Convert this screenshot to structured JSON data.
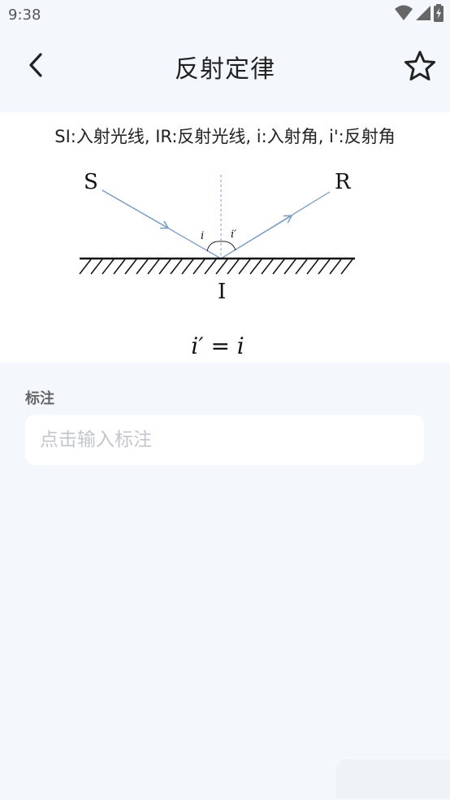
{
  "status_bar": {
    "time": "9:38",
    "icons": [
      "wifi-icon",
      "signal-icon",
      "battery-icon"
    ]
  },
  "app_bar": {
    "title": "反射定律",
    "back_icon": "chevron-left-icon",
    "favorite_icon": "star-outline-icon"
  },
  "content": {
    "caption": "SI:入射光线, IR:反射光线, i:入射角, i':反射角",
    "diagram": {
      "label_S": "S",
      "label_R": "R",
      "label_I": "I",
      "label_i": "i",
      "label_i_prime": "i′",
      "formula": "i′ = i"
    }
  },
  "note": {
    "label": "标注",
    "placeholder": "点击输入标注",
    "value": ""
  },
  "colors": {
    "background": "#f4f8fc",
    "card": "#ffffff",
    "ray": "#7a9cc6",
    "text": "#222222"
  }
}
